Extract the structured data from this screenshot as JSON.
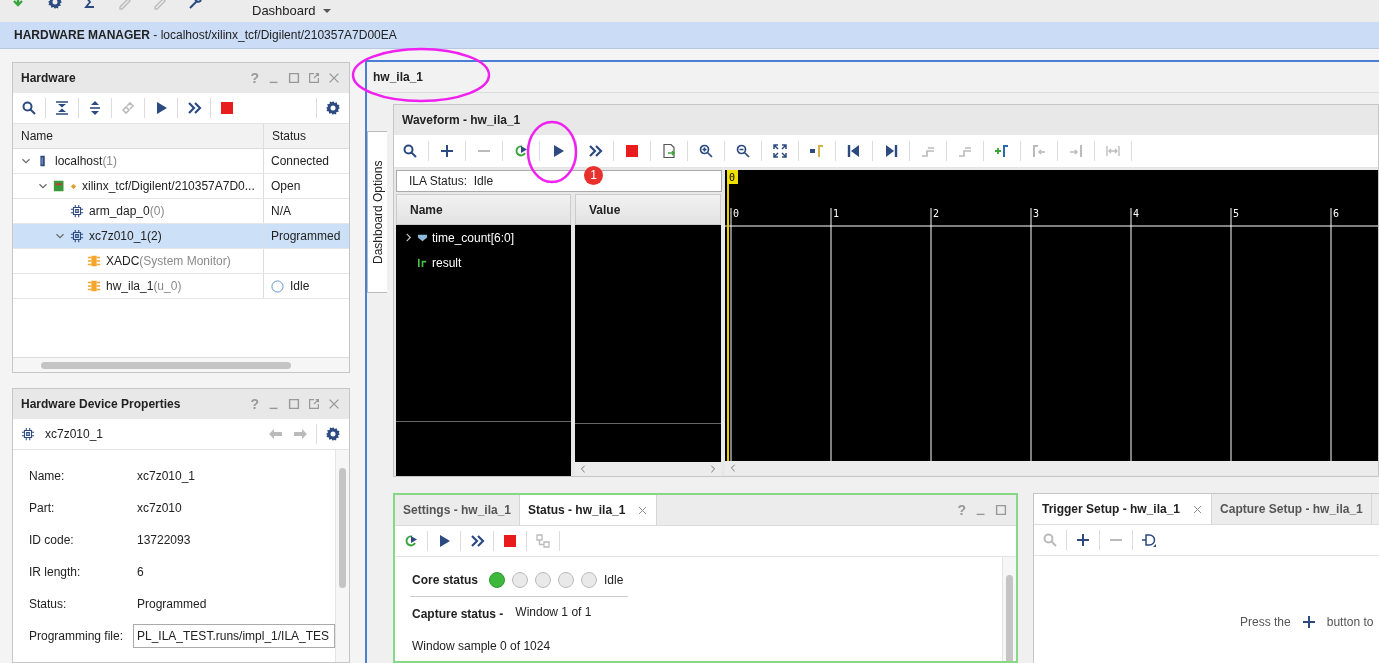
{
  "toolbar": {
    "menu": "Dashboard"
  },
  "banner": "**HARDWARE MANAGER** - localhost/xilinx_tcf/Digilent/210357A7D00EA",
  "hardware": {
    "title": "Hardware",
    "help": "?",
    "columns": [
      "Name",
      "Status"
    ],
    "rows": [
      {
        "kind": "host",
        "name": "localhost",
        "suffix": "(1)",
        "suffix_muted": true,
        "status": "Connected",
        "expanded": true,
        "selected": false,
        "children": [
          {
            "kind": "board",
            "name": "xilinx_tcf/Digilent/210357A7D0...",
            "status": "Open",
            "expanded": true,
            "selected": false,
            "children": [
              {
                "kind": "chip",
                "name": "arm_dap_0",
                "suffix": "(0)",
                "suffix_muted": true,
                "status": "N/A",
                "selected": false
              },
              {
                "kind": "chip",
                "name": "xc7z010_1",
                "suffix": "(2)",
                "suffix_muted": false,
                "status": "Programmed",
                "expanded": true,
                "selected": true,
                "children": [
                  {
                    "kind": "core",
                    "name": "XADC",
                    "suffix": "(System Monitor)",
                    "suffix_muted": true,
                    "selected": false
                  },
                  {
                    "kind": "core",
                    "name": "hw_ila_1",
                    "suffix": "(u_0)",
                    "suffix_muted": true,
                    "status": "Idle",
                    "status_indicator": true,
                    "selected": false
                  }
                ]
              }
            ]
          }
        ]
      }
    ]
  },
  "properties": {
    "title": "Hardware Device Properties",
    "help": "?",
    "device": "xc7z010_1",
    "fields": [
      {
        "label": "Name:",
        "value": "xc7z010_1",
        "kind": "text"
      },
      {
        "label": "Part:",
        "value": "xc7z010",
        "kind": "text"
      },
      {
        "label": "ID code:",
        "value": "13722093",
        "kind": "text"
      },
      {
        "label": "IR length:",
        "value": "6",
        "kind": "text"
      },
      {
        "label": "Status:",
        "value": "Programmed",
        "kind": "text"
      },
      {
        "label": "Programming file:",
        "value": "PL_ILA_TEST.runs/impl_1/ILA_TES",
        "kind": "field"
      }
    ]
  },
  "ila": {
    "tab": "hw_ila_1",
    "side_tab": "Dashboard Options"
  },
  "waveform": {
    "title": "Waveform - hw_ila_1",
    "status": "ILA Status:  Idle",
    "columns": [
      "Name",
      "Value"
    ],
    "signals": [
      {
        "name": "time_count[6:0]",
        "kind": "bus",
        "expanded": false
      },
      {
        "name": "result",
        "kind": "bit"
      }
    ],
    "cursor": "0",
    "ticks": [
      "0",
      "1",
      "2",
      "3",
      "4",
      "5",
      "6"
    ]
  },
  "status_panel": {
    "help": "?",
    "tabs": [
      {
        "label": "Settings - hw_ila_1",
        "selected": false
      },
      {
        "label": "Status - hw_ila_1",
        "selected": true
      }
    ],
    "core_label": "Core status",
    "leds": [
      {
        "on": true
      },
      {
        "on": false
      },
      {
        "on": false
      },
      {
        "on": false
      },
      {
        "on": false
      }
    ],
    "core_state": "Idle",
    "capture_label": "Capture status -",
    "capture_value": "Window 1 of 1",
    "sample": "Window sample 0 of 1024"
  },
  "trigger_panel": {
    "tabs": [
      {
        "label": "Trigger Setup - hw_ila_1",
        "selected": true
      },
      {
        "label": "Capture Setup - hw_ila_1",
        "selected": false
      }
    ],
    "hint_before": "Press the",
    "hint_after": "button to"
  },
  "annotations": {
    "badge": "1"
  }
}
